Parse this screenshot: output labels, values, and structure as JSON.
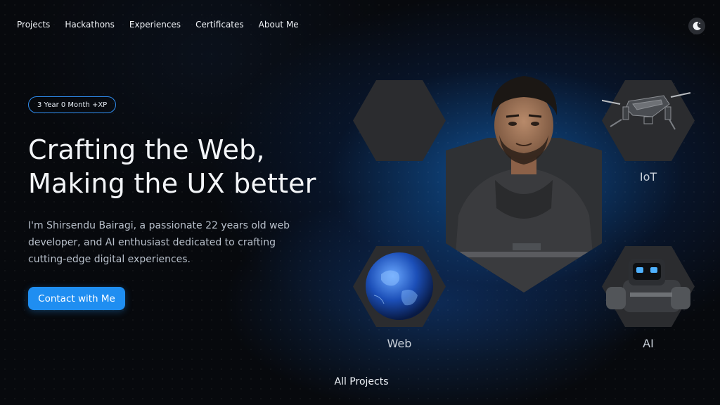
{
  "nav": {
    "items": [
      "Projects",
      "Hackathons",
      "Experiences",
      "Certificates",
      "About Me"
    ]
  },
  "theme_toggle": {
    "icon": "moon-icon"
  },
  "hero": {
    "badge": "3 Year 0 Month +XP",
    "headline_line1": "Crafting the Web,",
    "headline_line2": "Making the UX better",
    "intro": "I'm Shirsendu Bairagi, a passionate 22 years old web developer, and AI enthusiast dedicated to crafting cutting-edge digital experiences.",
    "cta_label": "Contact with Me"
  },
  "tiles": {
    "iot_label": "IoT",
    "web_label": "Web",
    "ai_label": "AI"
  },
  "footer": {
    "all_projects": "All Projects"
  },
  "colors": {
    "accent": "#1f8ef1",
    "background": "#07090d",
    "hex_fill": "#2b2c2f"
  }
}
